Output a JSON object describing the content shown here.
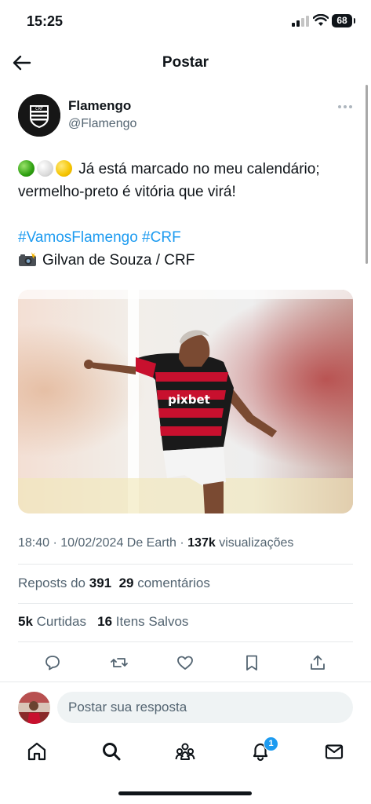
{
  "status_bar": {
    "time": "15:25",
    "battery": "68"
  },
  "header": {
    "title": "Postar"
  },
  "author": {
    "name": "Flamengo",
    "handle": "@Flamengo"
  },
  "post": {
    "line1": "Já está marcado no meu calendário;",
    "line2": "vermelho-preto é vitória que virá!",
    "hashtags": "#VamosFlamengo #CRF",
    "credit": "Gilvan de Souza / CRF"
  },
  "meta": {
    "datetime": "18:40 · 10/02/2024 De Earth ·",
    "views_count": "137k",
    "views_label": "visualizações"
  },
  "stats": {
    "reposts_label": "Reposts do",
    "reposts_count": "391",
    "comments_count": "29",
    "comments_label": "comentários",
    "likes_count": "5k",
    "likes_label": "Curtidas",
    "saved_count": "16",
    "saved_label": "Itens Salvos"
  },
  "reply": {
    "placeholder": "Postar sua resposta"
  },
  "tabbar": {
    "notification_badge": "1"
  },
  "icons": [
    "back-arrow-icon",
    "more-icon",
    "reply-icon",
    "repost-icon",
    "like-icon",
    "bookmark-icon",
    "share-icon",
    "home-icon",
    "search-icon",
    "communities-icon",
    "notifications-icon",
    "messages-icon"
  ],
  "colors": {
    "accent": "#1d9bf0",
    "text": "#0f1419",
    "secondary_text": "#536471",
    "input_bg": "#eff3f4"
  }
}
